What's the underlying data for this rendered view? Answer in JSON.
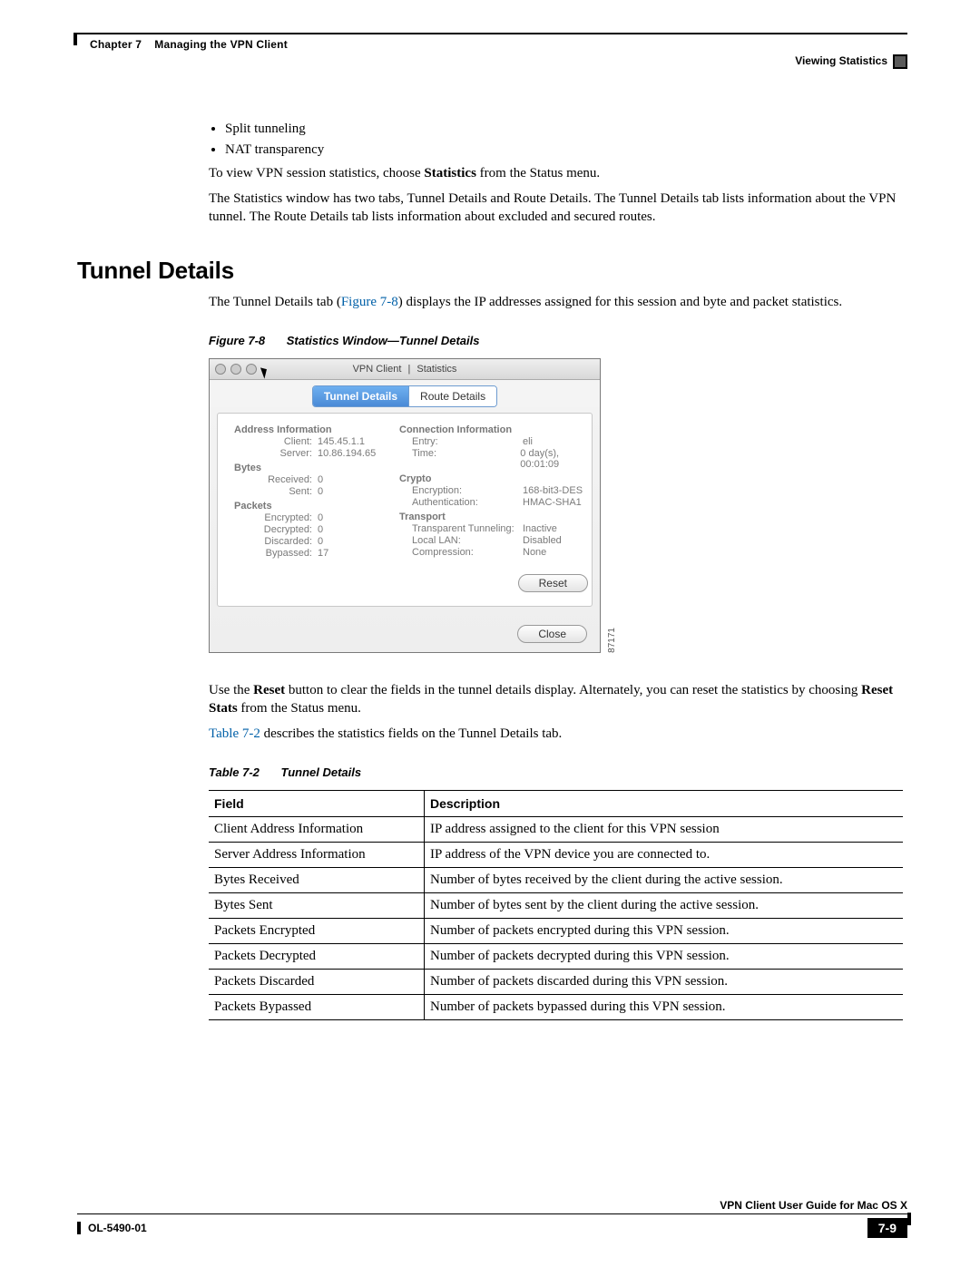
{
  "header": {
    "chapter_label": "Chapter 7",
    "chapter_title": "Managing the VPN Client",
    "section": "Viewing Statistics"
  },
  "bullets": [
    "Split tunneling",
    "NAT transparency"
  ],
  "para1_pre": "To view VPN session statistics, choose ",
  "para1_bold": "Statistics",
  "para1_post": " from the Status menu.",
  "para2": "The Statistics window has two tabs, Tunnel Details and Route Details. The Tunnel Details tab lists information about the VPN tunnel. The Route Details tab lists information about excluded and secured routes.",
  "section_heading": "Tunnel Details",
  "para3_pre": "The Tunnel Details tab (",
  "para3_link": "Figure 7-8",
  "para3_post": ") displays the IP addresses assigned for this session and byte and packet statistics.",
  "figcap_num": "Figure 7-8",
  "figcap_title": "Statistics Window—Tunnel Details",
  "figure": {
    "window_title_left": "VPN Client",
    "window_title_right": "Statistics",
    "tabs": {
      "active": "Tunnel Details",
      "other": "Route Details"
    },
    "address_hdr": "Address Information",
    "conn_hdr": "Connection Information",
    "bytes_hdr": "Bytes",
    "crypto_hdr": "Crypto",
    "packets_hdr": "Packets",
    "transport_hdr": "Transport",
    "client_k": "Client:",
    "client_v": "145.45.1.1",
    "server_k": "Server:",
    "server_v": "10.86.194.65",
    "entry_k": "Entry:",
    "entry_v": "eli",
    "time_k": "Time:",
    "time_v": "0 day(s), 00:01:09",
    "recv_k": "Received:",
    "recv_v": "0",
    "sent_k": "Sent:",
    "sent_v": "0",
    "encp_k": "Encryption:",
    "encp_v": "168-bit3-DES",
    "auth_k": "Authentication:",
    "auth_v": "HMAC-SHA1",
    "penc_k": "Encrypted:",
    "penc_v": "0",
    "pdec_k": "Decrypted:",
    "pdec_v": "0",
    "pdis_k": "Discarded:",
    "pdis_v": "0",
    "pbyp_k": "Bypassed:",
    "pbyp_v": "17",
    "tt_k": "Transparent Tunneling:",
    "tt_v": "Inactive",
    "ll_k": "Local LAN:",
    "ll_v": "Disabled",
    "cmp_k": "Compression:",
    "cmp_v": "None",
    "reset": "Reset",
    "close": "Close",
    "side_id": "87171"
  },
  "para4_a": "Use the ",
  "para4_b": "Reset",
  "para4_c": " button to clear the fields in the tunnel details display. Alternately, you can reset the statistics by choosing ",
  "para4_d": "Reset Stats",
  "para4_e": " from the Status menu.",
  "para5_link": "Table 7-2",
  "para5_post": " describes the statistics fields on the Tunnel Details tab.",
  "tabcap_num": "Table 7-2",
  "tabcap_title": "Tunnel Details",
  "table": {
    "h1": "Field",
    "h2": "Description",
    "rows": [
      {
        "f": "Client Address Information",
        "d": "IP address assigned to the client for this VPN session"
      },
      {
        "f": "Server Address Information",
        "d": "IP address of the VPN device you are connected to."
      },
      {
        "f": "Bytes Received",
        "d": "Number of bytes received by the client during the active session."
      },
      {
        "f": "Bytes Sent",
        "d": "Number of bytes sent by the client during the active session."
      },
      {
        "f": "Packets Encrypted",
        "d": "Number of packets encrypted during this VPN session."
      },
      {
        "f": "Packets Decrypted",
        "d": "Number of packets decrypted during this VPN session."
      },
      {
        "f": "Packets Discarded",
        "d": "Number of packets discarded during this VPN session."
      },
      {
        "f": "Packets Bypassed",
        "d": "Number of packets bypassed during this VPN session."
      }
    ]
  },
  "footer": {
    "guide": "VPN Client User Guide for Mac OS X",
    "docid": "OL-5490-01",
    "pagenum": "7-9"
  }
}
